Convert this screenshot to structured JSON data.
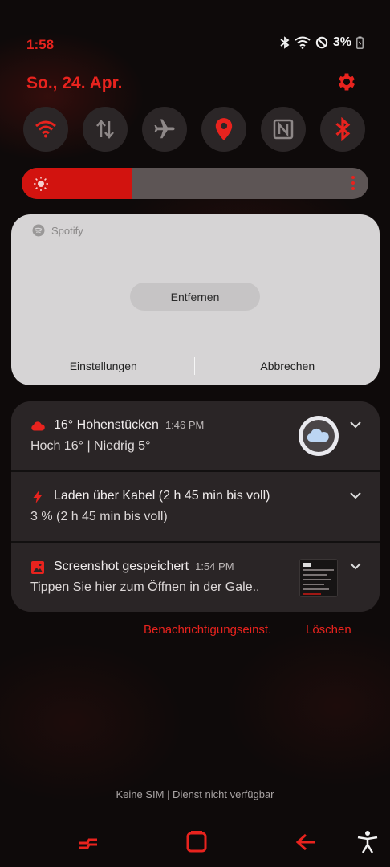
{
  "status_bar": {
    "time": "1:58",
    "battery": "3%",
    "icons": [
      "bluetooth-icon",
      "wifi-icon",
      "do-not-disturb-icon",
      "battery-charging-icon"
    ]
  },
  "header": {
    "date": "So., 24. Apr.",
    "settings_icon": "gear-icon"
  },
  "quick_toggles": [
    {
      "name": "wifi",
      "icon": "wifi-icon",
      "active": true
    },
    {
      "name": "mobile-data",
      "icon": "data-arrows-icon",
      "active": false
    },
    {
      "name": "airplane-mode",
      "icon": "airplane-icon",
      "active": false
    },
    {
      "name": "location",
      "icon": "location-pin-icon",
      "active": true
    },
    {
      "name": "nfc",
      "icon": "nfc-icon",
      "active": false
    },
    {
      "name": "bluetooth",
      "icon": "bluetooth-icon",
      "active": true
    }
  ],
  "brightness": {
    "level": 0.32
  },
  "spotify_card": {
    "app_name": "Spotify",
    "remove_label": "Entfernen",
    "settings_label": "Einstellungen",
    "cancel_label": "Abbrechen"
  },
  "notifications": [
    {
      "icon": "cloud-icon",
      "title": "16° Hohenstücken",
      "time": "1:46 PM",
      "body": "Hoch 16° | Niedrig 5°"
    },
    {
      "icon": "lightning-icon",
      "title": "Laden über Kabel (2 h 45 min bis voll)",
      "time": "",
      "body": "3 % (2 h 45 min bis voll)"
    },
    {
      "icon": "image-icon",
      "title": "Screenshot gespeichert",
      "time": "1:54 PM",
      "body": "Tippen Sie hier zum Öffnen in der Gale.."
    }
  ],
  "shade_actions": {
    "notification_settings": "Benachrichtigungseinst.",
    "clear_all": "Löschen"
  },
  "carrier_text": "Keine SIM | Dienst nicht verfügbar",
  "colors": {
    "accent": "#e8231e",
    "toggle_bg": "#2b2627",
    "card_bg": "#d6d4d5",
    "notif_bg": "#2a2526"
  }
}
